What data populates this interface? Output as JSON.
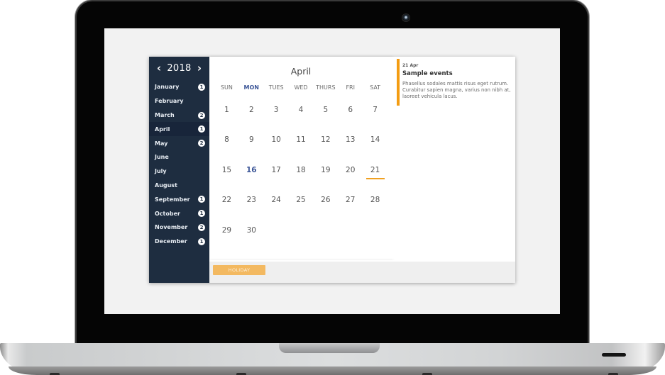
{
  "device": {
    "type": "laptop",
    "icons": [
      "camera-icon"
    ]
  },
  "calendar": {
    "year": "2018",
    "prev_icon": "chevron-left-icon",
    "next_icon": "chevron-right-icon",
    "months": [
      {
        "label": "January",
        "count": "1"
      },
      {
        "label": "February",
        "count": null
      },
      {
        "label": "March",
        "count": "2"
      },
      {
        "label": "April",
        "count": "1",
        "active": true
      },
      {
        "label": "May",
        "count": "2"
      },
      {
        "label": "June",
        "count": null
      },
      {
        "label": "July",
        "count": null
      },
      {
        "label": "August",
        "count": null
      },
      {
        "label": "September",
        "count": "1"
      },
      {
        "label": "October",
        "count": "1"
      },
      {
        "label": "November",
        "count": "2"
      },
      {
        "label": "December",
        "count": "1"
      }
    ],
    "month_title": "April",
    "weekdays": [
      "SUN",
      "MON",
      "TUES",
      "WED",
      "THURS",
      "FRI",
      "SAT"
    ],
    "today_weekday_index": 1,
    "weeks": [
      [
        "1",
        "2",
        "3",
        "4",
        "5",
        "6",
        "7"
      ],
      [
        "8",
        "9",
        "10",
        "11",
        "12",
        "13",
        "14"
      ],
      [
        "15",
        "16",
        "17",
        "18",
        "19",
        "20",
        "21"
      ],
      [
        "22",
        "23",
        "24",
        "25",
        "26",
        "27",
        "28"
      ],
      [
        "29",
        "30",
        "",
        "",
        "",
        "",
        ""
      ]
    ],
    "today": "16",
    "event_days": [
      "21"
    ]
  },
  "events": [
    {
      "date": "21 Apr",
      "title": "Sample events",
      "description": "Phasellus sodales mattis risus eget rutrum. Curabitur sapien magna, varius non nibh at, laoreet vehicula lacus.",
      "color": "#f39c12"
    }
  ],
  "legend": {
    "holiday_label": "HOLIDAY",
    "holiday_color": "#f3b961"
  },
  "colors": {
    "sidebar": "#1e2d40",
    "accent": "#3b5597",
    "event": "#f39c12"
  }
}
